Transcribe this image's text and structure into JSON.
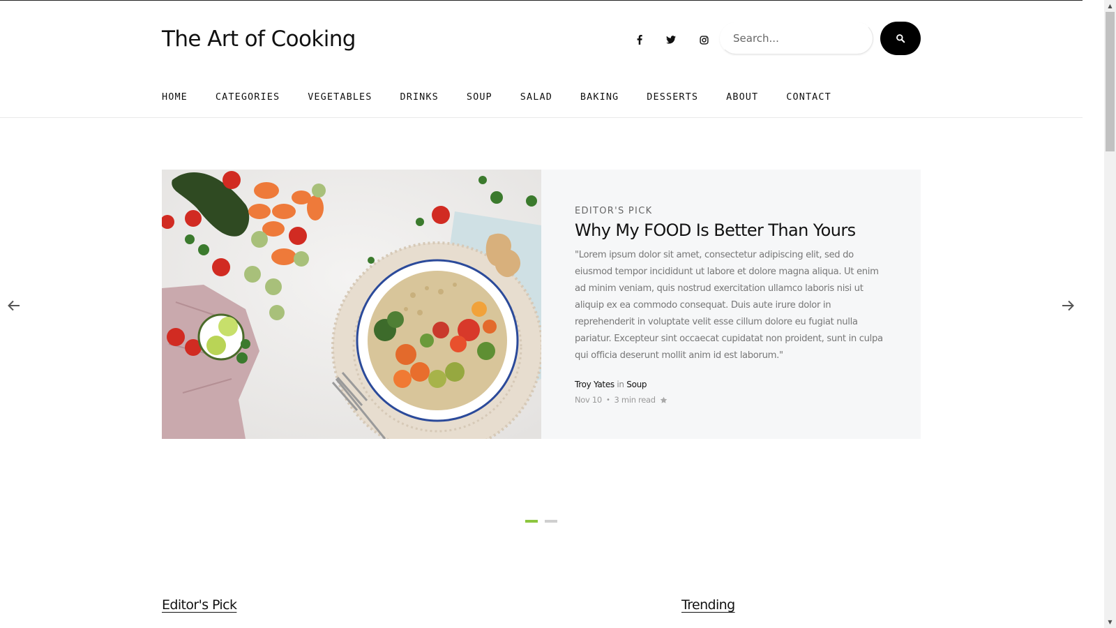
{
  "header": {
    "site_title": "The Art of Cooking",
    "social": [
      {
        "icon": "facebook-icon"
      },
      {
        "icon": "twitter-icon"
      },
      {
        "icon": "instagram-icon"
      }
    ],
    "search": {
      "placeholder": "Search...",
      "value": "",
      "button_icon": "search-icon"
    }
  },
  "nav": {
    "items": [
      "HOME",
      "CATEGORIES",
      "VEGETABLES",
      "DRINKS",
      "SOUP",
      "SALAD",
      "BAKING",
      "DESSERTS",
      "ABOUT",
      "CONTACT"
    ]
  },
  "featured": {
    "kicker": "EDITOR'S PICK",
    "title": "Why My FOOD Is Better Than Yours",
    "excerpt": "\"Lorem ipsum dolor sit amet, consectetur adipiscing elit, sed do eiusmod tempor incididunt ut labore et dolore magna aliqua. Ut enim ad minim veniam, quis nostrud exercitation ullamco laboris nisi ut aliquip ex ea commodo consequat. Duis aute irure dolor in reprehenderit in voluptate velit esse cillum dolore eu fugiat nulla pariatur. Excepteur sint occaecat cupidatat non proident, sunt in culpa qui officia deserunt mollit anim id est laborum.\"",
    "author": "Troy Yates",
    "in_word": "in",
    "category": "Soup",
    "date": "Nov 10",
    "read_time": "3 min read",
    "star_icon": "star-icon"
  },
  "slider": {
    "prev_icon": "arrow-left-icon",
    "next_icon": "arrow-right-icon",
    "dots": 2,
    "active_dot": 1,
    "accent_color": "#8dc63f"
  },
  "sections": {
    "left_title": "Editor's Pick",
    "right_title": "Trending"
  }
}
